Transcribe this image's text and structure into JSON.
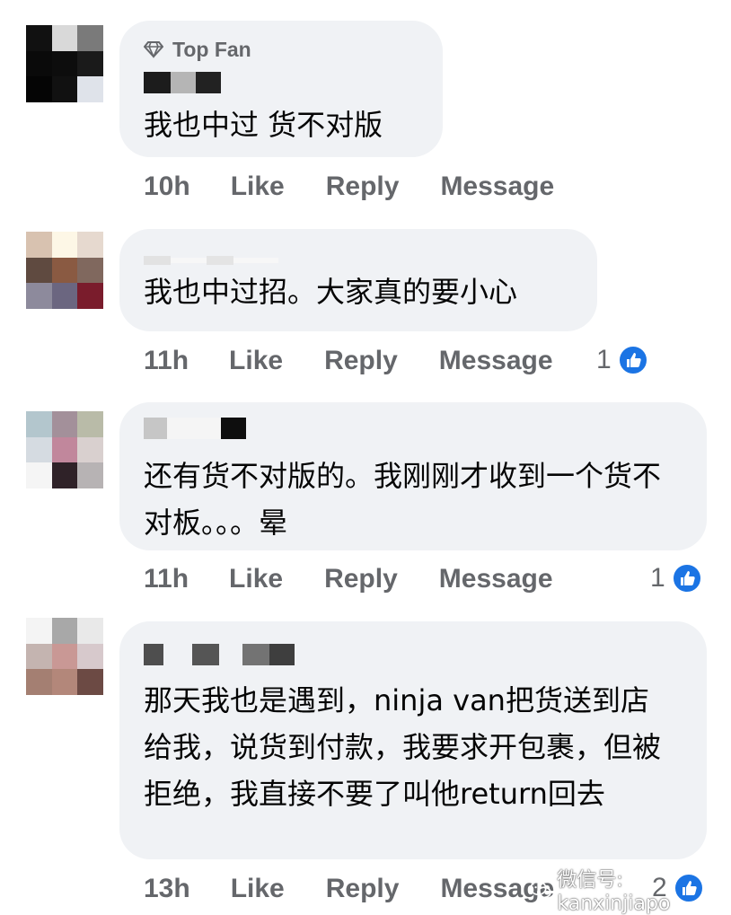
{
  "comments": [
    {
      "badge": "Top Fan",
      "text": "我也中过 货不对版",
      "time": "10h",
      "like": "Like",
      "reply": "Reply",
      "message": "Message",
      "reactions": ""
    },
    {
      "badge": "",
      "text": "我也中过招。大家真的要小心",
      "time": "11h",
      "like": "Like",
      "reply": "Reply",
      "message": "Message",
      "reactions": "1"
    },
    {
      "badge": "",
      "text": "还有货不对版的。我刚刚才收到一个货不对板。。。晕",
      "time": "11h",
      "like": "Like",
      "reply": "Reply",
      "message": "Message",
      "reactions": "1"
    },
    {
      "badge": "",
      "text": "那天我也是遇到，ninja van把货送到店给我，说货到付款，我要求开包裹，但被拒绝，我直接不要了叫他return回去",
      "time": "13h",
      "like": "Like",
      "reply": "Reply",
      "message": "Message",
      "reactions": "2"
    }
  ],
  "watermark": "微信号: kanxinjiapo",
  "colors": {
    "bubble": "#f0f2f5",
    "meta": "#65676b",
    "like_blue": "#1b74e4"
  },
  "icons": {
    "badge": "diamond-icon",
    "reaction": "thumbs-up-icon",
    "watermark": "wechat-icon"
  }
}
